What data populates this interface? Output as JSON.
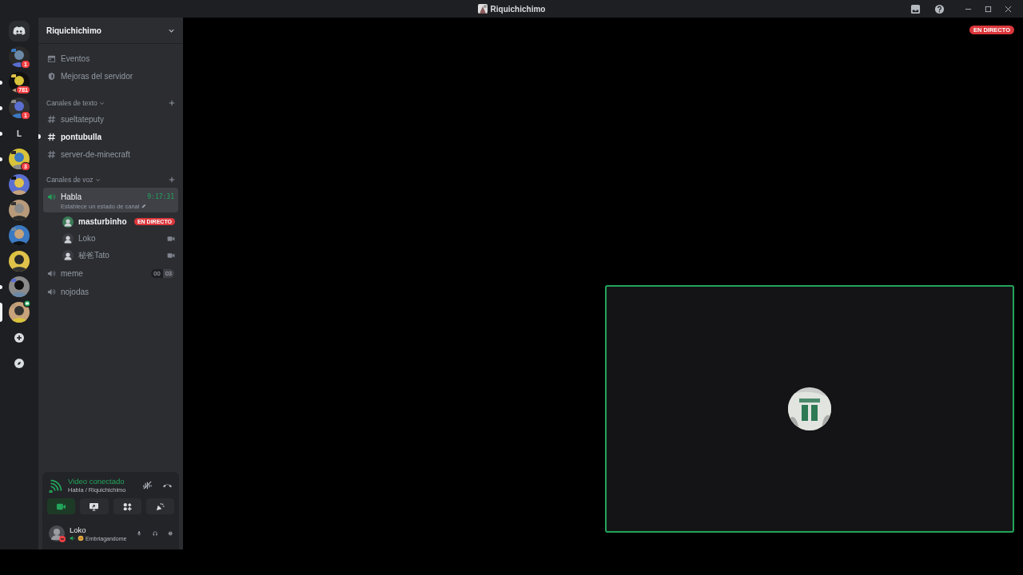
{
  "window": {
    "title": "Riquichichimo"
  },
  "servers": [
    {
      "kind": "home",
      "unread": false,
      "selected": false
    },
    {
      "kind": "picture",
      "badge": "1",
      "unread": false,
      "selected": false
    },
    {
      "kind": "picture",
      "badge": "781",
      "unread": true,
      "selected": false
    },
    {
      "kind": "picture",
      "badge": "1",
      "unread": true,
      "selected": false
    },
    {
      "kind": "letter",
      "label": "L",
      "unread": true,
      "selected": false
    },
    {
      "kind": "picture",
      "badge": "3",
      "unread": true,
      "selected": false
    },
    {
      "kind": "picture",
      "unread": false,
      "selected": false
    },
    {
      "kind": "picture",
      "unread": false,
      "selected": false
    },
    {
      "kind": "picture",
      "unread": false,
      "selected": false
    },
    {
      "kind": "picture",
      "unread": false,
      "selected": false
    },
    {
      "kind": "picture",
      "unread": true,
      "selected": false
    },
    {
      "kind": "picture",
      "selected": true,
      "in_voice": true
    },
    {
      "kind": "add"
    },
    {
      "kind": "explore"
    }
  ],
  "sidebar": {
    "server_name": "Riquichichimo",
    "menu": [
      {
        "label": "Eventos",
        "kind": "events"
      },
      {
        "label": "Mejoras del servidor",
        "kind": "boost"
      }
    ],
    "categories": [
      {
        "name": "Canales de texto",
        "channels": [
          {
            "kind": "text",
            "name": "sueltateputy",
            "unread": false
          },
          {
            "kind": "text",
            "name": "pontubulla",
            "unread": true
          },
          {
            "kind": "text",
            "name": "server-de-minecraft",
            "unread": false
          }
        ]
      },
      {
        "name": "Canales de voz",
        "channels": [
          {
            "kind": "voice",
            "name": "Habla",
            "connected": true,
            "timer": "9:17:31",
            "status": "Establece un estado de canal",
            "users": [
              {
                "name": "masturbinho",
                "live": "EN DIRECTO",
                "video": false,
                "streaming": true
              },
              {
                "name": "Loko",
                "video": true,
                "streaming": false
              },
              {
                "name": "秘爸Tato",
                "video": true,
                "streaming": false
              }
            ]
          },
          {
            "kind": "voice",
            "name": "meme",
            "connected": false,
            "counts": [
              "00",
              "03"
            ]
          },
          {
            "kind": "voice",
            "name": "nojodas",
            "connected": false
          }
        ]
      }
    ]
  },
  "voice_panel": {
    "status": "Video conectado",
    "location": "Habla / Riquichichimo",
    "actions": [
      {
        "kind": "camera",
        "on": true
      },
      {
        "kind": "screen",
        "on": false
      },
      {
        "kind": "activity",
        "on": false
      },
      {
        "kind": "soundboard",
        "on": false
      }
    ]
  },
  "user_panel": {
    "name": "Loko",
    "status": "Embriagandome"
  },
  "stage": {
    "live": "EN DIRECTO",
    "tile": {
      "speaking": true
    }
  }
}
